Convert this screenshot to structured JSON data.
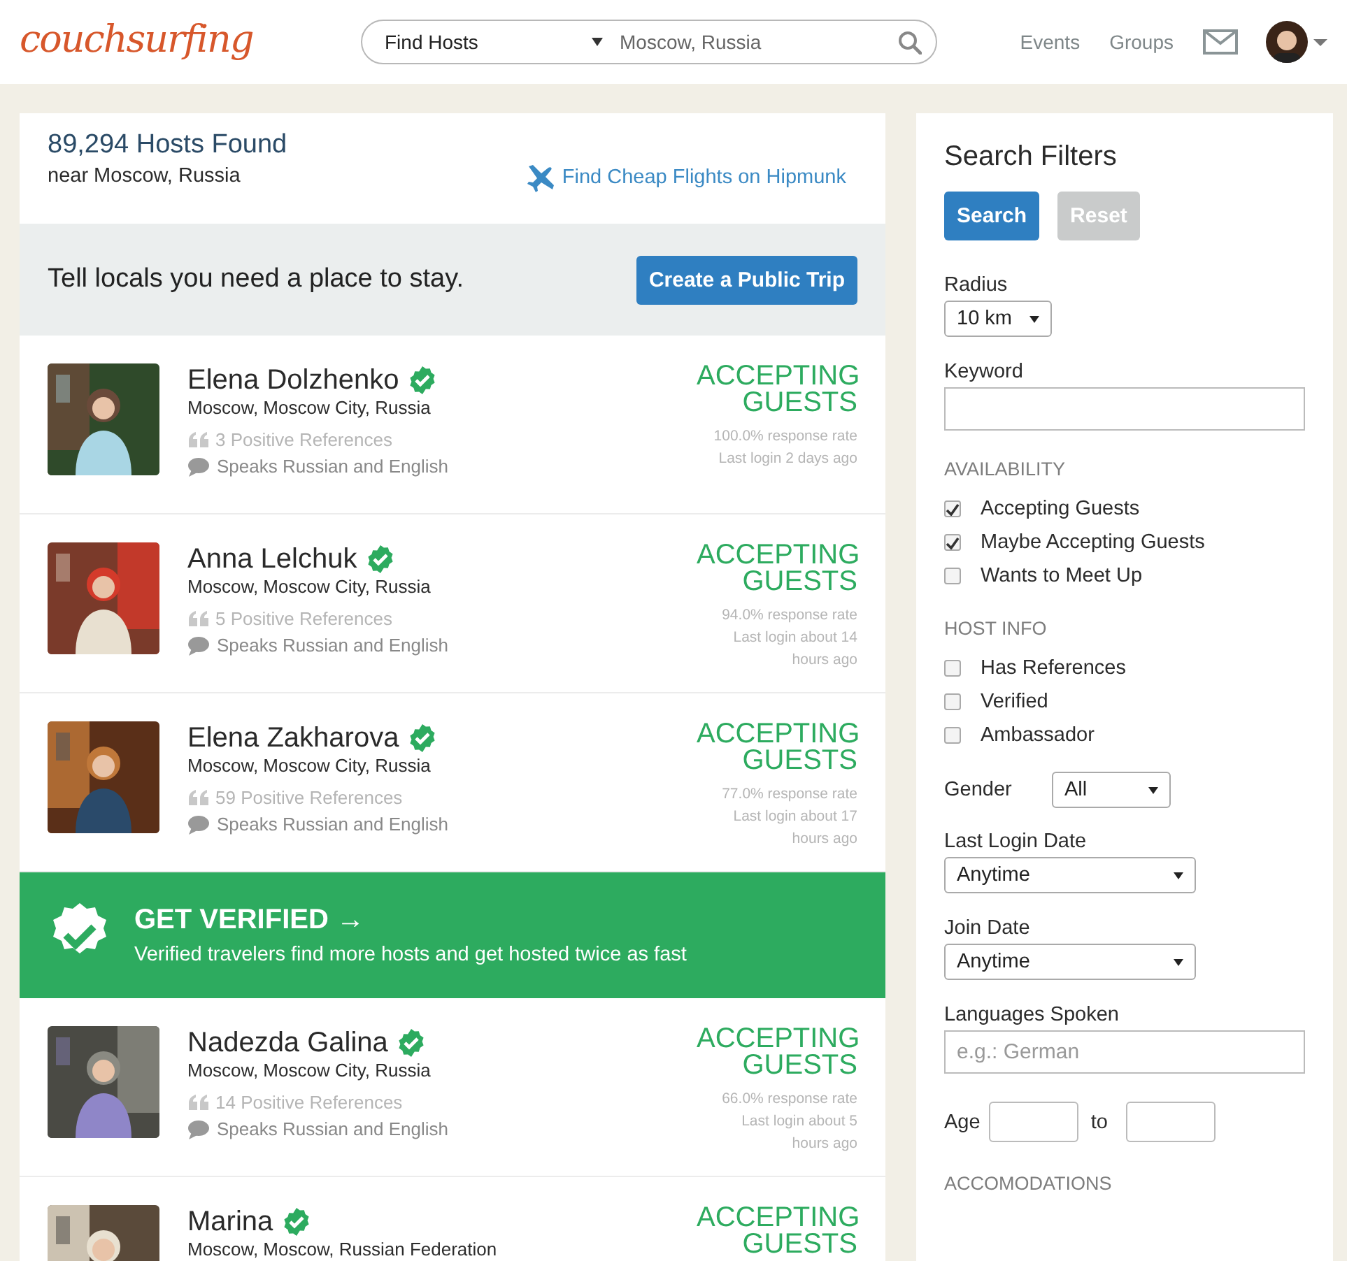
{
  "header": {
    "logo": "couchsurfing",
    "search": {
      "mode": "Find Hosts",
      "value": "Moscow, Russia"
    },
    "nav": [
      "Events",
      "Groups"
    ]
  },
  "results": {
    "count": "89,294 Hosts Found",
    "location": "near Moscow, Russia",
    "flights_link": "Find Cheap Flights on Hipmunk"
  },
  "trip_banner": {
    "text": "Tell locals you need a place to stay.",
    "button": "Create a Public Trip"
  },
  "listing": [
    {
      "kind": "host",
      "name": "Elena Dolzhenko",
      "verified": true,
      "location": "Moscow, Moscow City, Russia",
      "references": "3 Positive References",
      "languages": "Speaks Russian and English",
      "status": "ACCEPTING GUESTS",
      "response_rate": "100.0% response rate",
      "last_login": "Last login 2 days ago"
    },
    {
      "kind": "host",
      "name": "Anna Lelchuk",
      "verified": true,
      "location": "Moscow, Moscow City, Russia",
      "references": "5 Positive References",
      "languages": "Speaks Russian and English",
      "status": "ACCEPTING GUESTS",
      "response_rate": "94.0% response rate",
      "last_login": "Last login about 14 hours ago"
    },
    {
      "kind": "host",
      "name": "Elena Zakharova",
      "verified": true,
      "location": "Moscow, Moscow City, Russia",
      "references": "59 Positive References",
      "languages": "Speaks Russian and English",
      "status": "ACCEPTING GUESTS",
      "response_rate": "77.0% response rate",
      "last_login": "Last login about 17 hours ago"
    },
    {
      "kind": "promo",
      "title": "GET VERIFIED →",
      "text": "Verified travelers find more hosts and get hosted twice as fast"
    },
    {
      "kind": "host",
      "name": "Nadezda Galina",
      "verified": true,
      "location": "Moscow, Moscow City, Russia",
      "references": "14 Positive References",
      "languages": "Speaks Russian and English",
      "status": "ACCEPTING GUESTS",
      "response_rate": "66.0% response rate",
      "last_login": "Last login about 5 hours ago"
    },
    {
      "kind": "host",
      "name": "Marina",
      "verified": true,
      "location": "Moscow, Moscow, Russian Federation",
      "status": "ACCEPTING GUESTS"
    }
  ],
  "filters": {
    "title": "Search Filters",
    "buttons": [
      {
        "label": "Search",
        "disabled": false
      },
      {
        "label": "Reset",
        "disabled": true
      }
    ],
    "items": [
      {
        "kind": "short-select",
        "label": "Radius",
        "value": "10 km"
      },
      {
        "kind": "text",
        "label": "Keyword"
      },
      {
        "kind": "heading",
        "label": "AVAILABILITY"
      },
      {
        "kind": "checkbox",
        "label": "Accepting Guests",
        "checked": true
      },
      {
        "kind": "checkbox",
        "label": "Maybe Accepting Guests",
        "checked": true
      },
      {
        "kind": "checkbox",
        "label": "Wants to Meet Up",
        "checked": false
      },
      {
        "kind": "heading",
        "label": "HOST INFO"
      },
      {
        "kind": "checkbox",
        "label": "Has References",
        "checked": false
      },
      {
        "kind": "checkbox",
        "label": "Verified",
        "checked": false
      },
      {
        "kind": "checkbox",
        "label": "Ambassador",
        "checked": false
      },
      {
        "kind": "inline-select",
        "label": "Gender",
        "value": "All"
      },
      {
        "kind": "select",
        "label": "Last Login Date",
        "value": "Anytime"
      },
      {
        "kind": "select",
        "label": "Join Date",
        "value": "Anytime"
      },
      {
        "kind": "text",
        "label": "Languages Spoken",
        "placeholder": "e.g.: German"
      },
      {
        "kind": "range",
        "label": "Age",
        "separator": "to"
      },
      {
        "kind": "heading",
        "label": "ACCOMODATIONS"
      }
    ]
  }
}
